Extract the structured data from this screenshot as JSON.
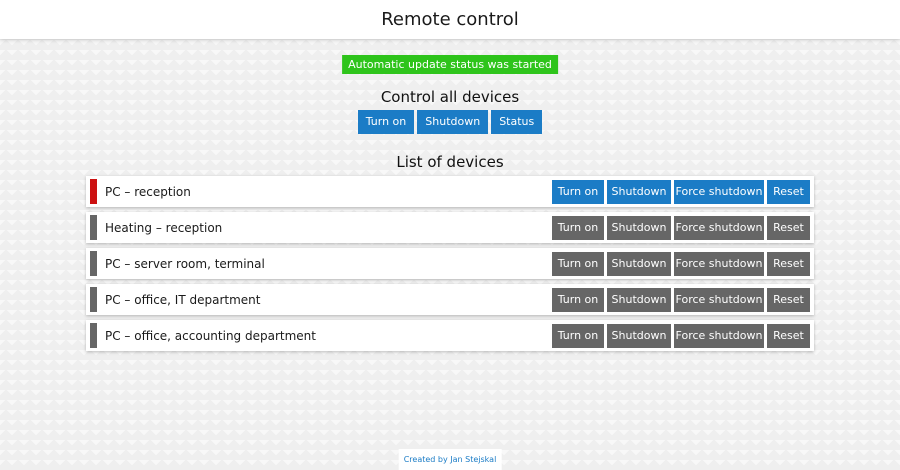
{
  "app": {
    "title": "Remote control"
  },
  "status_message": "Automatic update status was started",
  "control_all": {
    "heading": "Control all devices",
    "buttons": [
      "Turn on",
      "Shutdown",
      "Status"
    ]
  },
  "device_list": {
    "heading": "List of devices",
    "devices": [
      {
        "name": "PC – reception",
        "state": "off",
        "indicator_color": "#cc1111",
        "buttons_color": "blue"
      },
      {
        "name": "Heating – reception",
        "state": "unknown",
        "indicator_color": "#666666",
        "buttons_color": "gray"
      },
      {
        "name": "PC – server room, terminal",
        "state": "unknown",
        "indicator_color": "#666666",
        "buttons_color": "gray"
      },
      {
        "name": "PC – office, IT department",
        "state": "unknown",
        "indicator_color": "#666666",
        "buttons_color": "gray"
      },
      {
        "name": "PC – office, accounting department",
        "state": "unknown",
        "indicator_color": "#666666",
        "buttons_color": "gray"
      }
    ],
    "action_labels": {
      "turn_on": "Turn on",
      "shutdown": "Shutdown",
      "force_shutdown": "Force shutdown",
      "reset": "Reset"
    }
  },
  "footer": {
    "credit": "Created by Jan Stejskal"
  },
  "colors": {
    "accent_blue": "#1b7cc6",
    "status_green": "#2ec41b",
    "inactive_gray": "#666666",
    "off_red": "#cc1111"
  }
}
